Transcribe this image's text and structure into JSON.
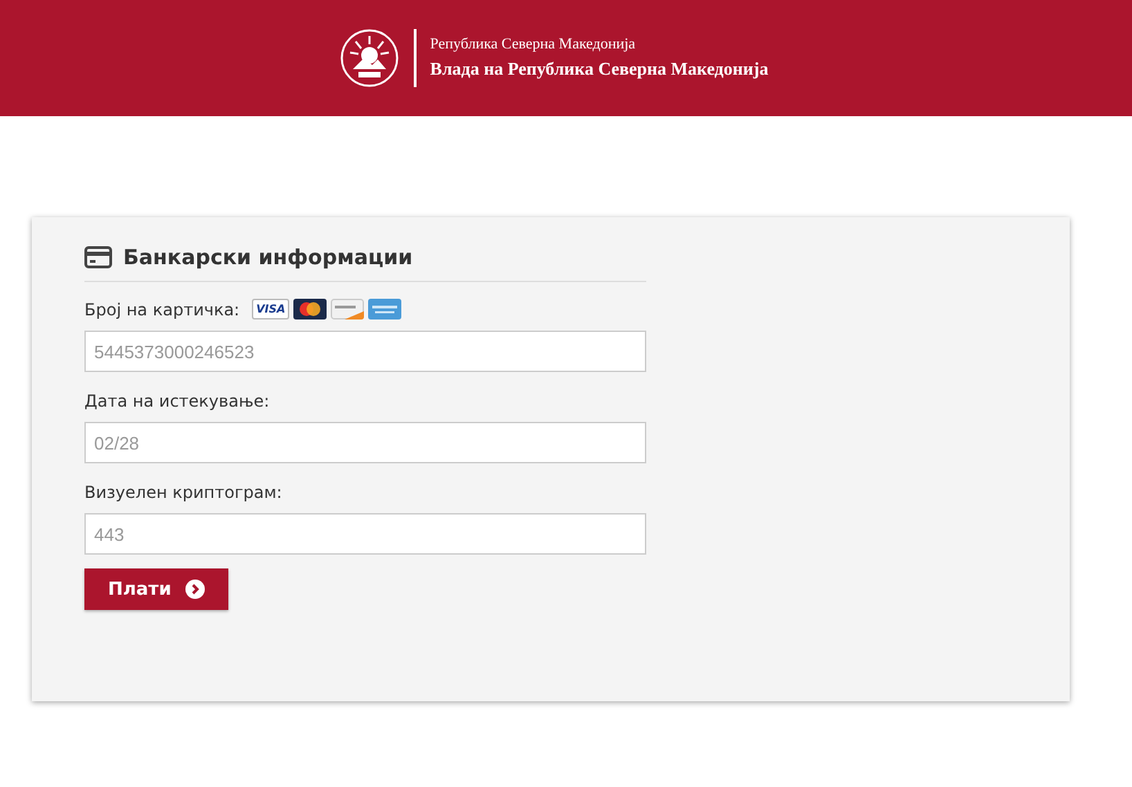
{
  "header": {
    "subtitle": "Република Северна Македонија",
    "title": "Влада на Република Северна Македонија"
  },
  "form": {
    "title": "Банкарски информации",
    "fields": [
      {
        "label": "Број на картичка:",
        "placeholder": "5445373000246523",
        "card_logos": [
          {
            "kind": "visa",
            "label": "VISA"
          },
          {
            "kind": "mastercard"
          },
          {
            "kind": "discover"
          },
          {
            "kind": "amex"
          }
        ]
      },
      {
        "label": "Дата на истекување:",
        "placeholder": "02/28"
      },
      {
        "label": "Визуелен криптограм:",
        "placeholder": "443"
      }
    ],
    "submit": "Плати"
  }
}
